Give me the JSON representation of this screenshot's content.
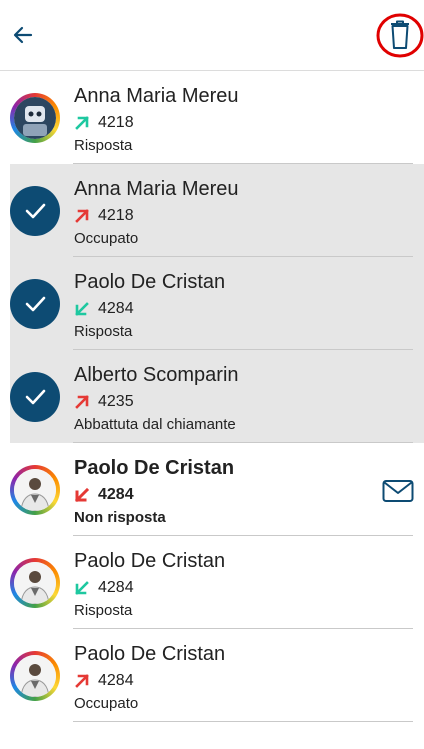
{
  "colors": {
    "accent": "#0d4b73",
    "outgoing_ok": "#1ec8a0",
    "outgoing_busy": "#e53935",
    "incoming_ok": "#1ec8a0",
    "missed": "#e53935",
    "highlight_ring": "#e00000"
  },
  "header": {
    "back_icon": "arrow-left-icon",
    "delete_icon": "trash-icon"
  },
  "calls": [
    {
      "name": "Anna Maria Mereu",
      "number": "4218",
      "status": "Risposta",
      "direction": "outgoing",
      "result": "ok",
      "selected": false,
      "bold": false
    },
    {
      "name": "Anna Maria Mereu",
      "number": "4218",
      "status": "Occupato",
      "direction": "outgoing",
      "result": "fail",
      "selected": true,
      "bold": false
    },
    {
      "name": "Paolo De Cristan",
      "number": "4284",
      "status": "Risposta",
      "direction": "incoming",
      "result": "ok",
      "selected": true,
      "bold": false
    },
    {
      "name": "Alberto Scomparin",
      "number": "4235",
      "status": "Abbattuta dal chiamante",
      "direction": "outgoing",
      "result": "fail",
      "selected": true,
      "bold": false
    },
    {
      "name": "Paolo De Cristan",
      "number": "4284",
      "status": "Non risposta",
      "direction": "incoming",
      "result": "fail",
      "selected": false,
      "bold": true,
      "mail": true
    },
    {
      "name": "Paolo De Cristan",
      "number": "4284",
      "status": "Risposta",
      "direction": "incoming",
      "result": "ok",
      "selected": false,
      "bold": false
    },
    {
      "name": "Paolo De Cristan",
      "number": "4284",
      "status": "Occupato",
      "direction": "outgoing",
      "result": "fail",
      "selected": false,
      "bold": false
    }
  ]
}
